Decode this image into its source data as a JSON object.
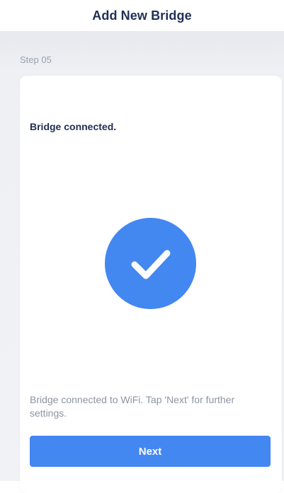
{
  "header": {
    "title": "Add New Bridge"
  },
  "step": {
    "label": "Step 05"
  },
  "card": {
    "title": "Bridge connected.",
    "status_icon": "checkmark-circle-icon",
    "description": "Bridge connected to WiFi. Tap 'Next' for further settings.",
    "next_label": "Next"
  },
  "colors": {
    "accent": "#4387f1",
    "title_text": "#1f2f55",
    "muted_text": "#8d94a0",
    "background": "#eef0f4"
  }
}
